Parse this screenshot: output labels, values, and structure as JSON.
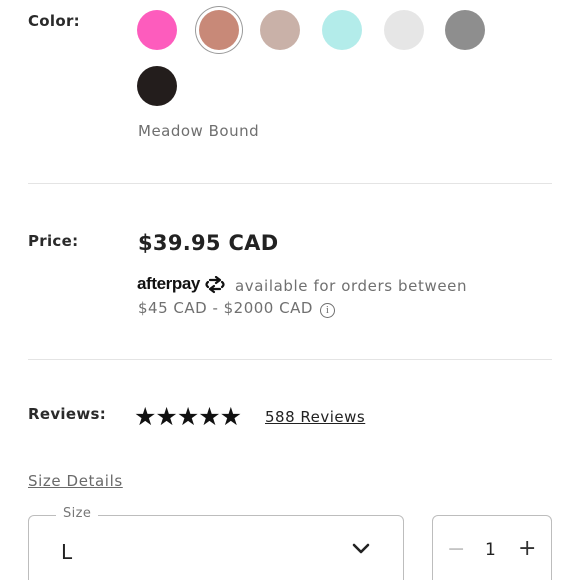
{
  "color": {
    "label": "Color:",
    "selected_name": "Meadow Bound",
    "swatches": [
      {
        "name": "hot-pink",
        "hex": "#fd5cbd",
        "selected": false
      },
      {
        "name": "terracotta",
        "hex": "#c88978",
        "selected": true
      },
      {
        "name": "taupe",
        "hex": "#c9b1a8",
        "selected": false
      },
      {
        "name": "light-aqua",
        "hex": "#b3ecea",
        "selected": false
      },
      {
        "name": "light-grey",
        "hex": "#e6e6e6",
        "selected": false
      },
      {
        "name": "heather-grey",
        "hex": "#8e8e8e",
        "selected": false
      },
      {
        "name": "black",
        "hex": "#231d1c",
        "selected": false
      }
    ]
  },
  "price": {
    "label": "Price:",
    "value": "$39.95 CAD"
  },
  "afterpay": {
    "logo": "afterpay",
    "icon": "afterpay-arrows-icon",
    "text": "available for orders between",
    "range": "$45 CAD - $2000 CAD",
    "info_icon": "ⓘ"
  },
  "reviews": {
    "label": "Reviews:",
    "stars": "★★★★★",
    "rating_stars": 4.5,
    "count_link": "588 Reviews"
  },
  "size": {
    "details_link": "Size Details",
    "legend": "Size",
    "value": "L",
    "chevron_icon": "chevron-down-icon"
  },
  "quantity": {
    "minus": "−",
    "value": "1",
    "plus": "+"
  }
}
